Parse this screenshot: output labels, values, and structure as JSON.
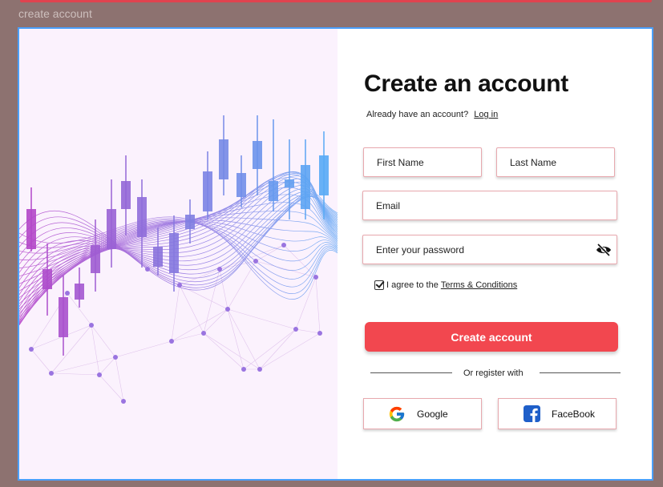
{
  "frame_label": "create account",
  "form": {
    "title": "Create an account",
    "subtitle_text": "Already have an account?",
    "login_link": "Log in",
    "first_name_placeholder": "First Name",
    "last_name_placeholder": "Last Name",
    "email_placeholder": "Email",
    "password_placeholder": "Enter your password",
    "terms_text": "I agree to the",
    "terms_link": "Terms & Conditions",
    "terms_checked": true,
    "submit_label": "Create account",
    "divider_text": "Or register with",
    "google_label": "Google",
    "facebook_label": "FaceBook"
  },
  "icons": {
    "password_toggle": "eye-slash-icon",
    "google": "google-icon",
    "facebook": "facebook-icon",
    "checkbox": "checkmark-icon"
  },
  "colors": {
    "accent": "#f2474f",
    "frame_border": "#4aa0ff",
    "field_border": "#e8a8ae",
    "background": "#8d7270"
  }
}
